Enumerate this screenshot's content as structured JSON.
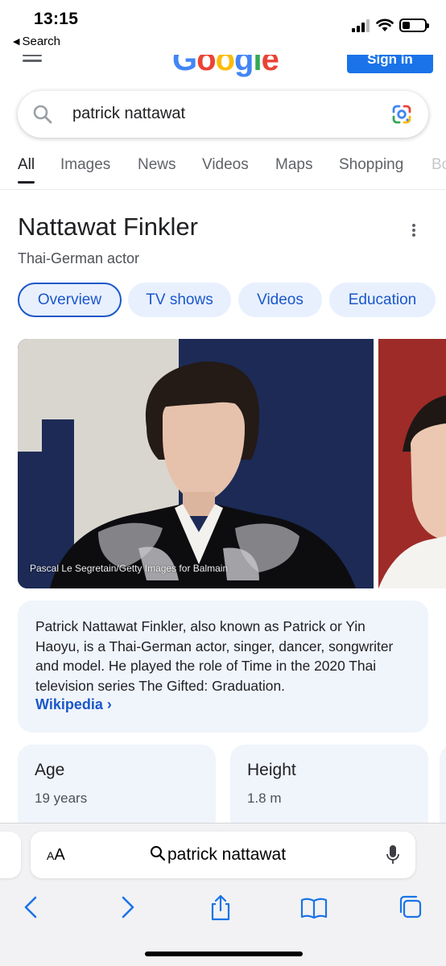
{
  "status_bar": {
    "time": "13:15",
    "back_label": "Search"
  },
  "google": {
    "logo": "Google",
    "sign_in": "Sign in"
  },
  "search": {
    "query": "patrick nattawat"
  },
  "tabs": [
    {
      "label": "All"
    },
    {
      "label": "Images"
    },
    {
      "label": "News"
    },
    {
      "label": "Videos"
    },
    {
      "label": "Maps"
    },
    {
      "label": "Shopping"
    },
    {
      "label": "Bo"
    }
  ],
  "knowledge_panel": {
    "title": "Nattawat Finkler",
    "subtitle": "Thai-German actor",
    "chips": [
      {
        "label": "Overview"
      },
      {
        "label": "TV shows"
      },
      {
        "label": "Videos"
      },
      {
        "label": "Education"
      }
    ],
    "image_credit": "Pascal Le Segretain/Getty Images for Balmain",
    "description": "Patrick Nattawat Finkler, also known as Patrick or Yin Haoyu, is a Thai-German actor, singer, dancer, songwriter and model. He played the role of Time in the 2020 Thai television series The Gifted: Graduation.",
    "source_link": "Wikipedia",
    "attributes": [
      {
        "label": "Age",
        "value": "19 years"
      },
      {
        "label": "Height",
        "value": "1.8 m"
      }
    ]
  },
  "safari": {
    "aa_label_small": "A",
    "aa_label_big": "A",
    "address_query": "patrick nattawat"
  },
  "colors": {
    "google_blue": "#1a73e8",
    "link_blue": "#1a57c9",
    "card_bg": "#f0f4fb"
  }
}
